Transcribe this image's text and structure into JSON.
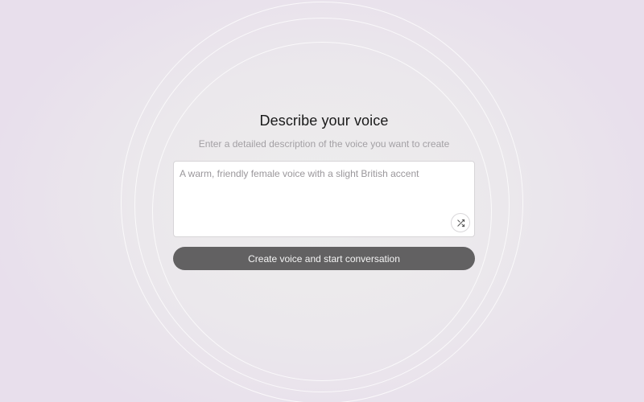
{
  "main": {
    "title": "Describe your voice",
    "subtitle": "Enter a detailed description of the voice you want to create",
    "description_input": {
      "value": "",
      "placeholder": "A warm, friendly female voice with a slight British accent"
    },
    "shuffle_icon": "shuffle-icon",
    "submit_label": "Create voice and start conversation"
  },
  "colors": {
    "button_bg": "#626162",
    "background_tint": "#e8dfec"
  }
}
